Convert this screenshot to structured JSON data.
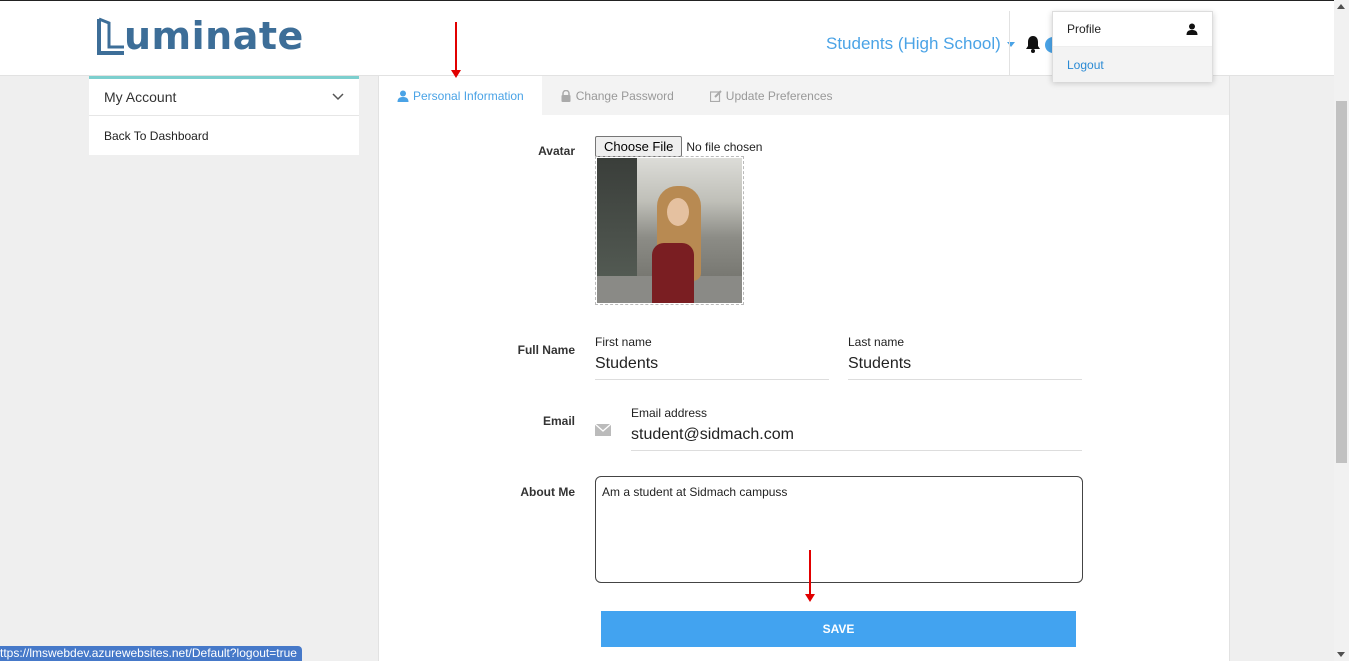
{
  "header": {
    "logo_text": "uminate",
    "role_selector": "Students (High School)",
    "brand_color": "#3d6e98",
    "accent_color": "#4aa3e6"
  },
  "user_menu": {
    "profile_label": "Profile",
    "logout_label": "Logout"
  },
  "sidebar": {
    "section_title": "My Account",
    "items": [
      {
        "label": "Back To Dashboard"
      }
    ]
  },
  "tabs": [
    {
      "label": "Personal Information",
      "icon": "user-icon",
      "active": true
    },
    {
      "label": "Change Password",
      "icon": "lock-icon",
      "active": false
    },
    {
      "label": "Update Preferences",
      "icon": "edit-icon",
      "active": false
    }
  ],
  "form": {
    "avatar_label": "Avatar",
    "choose_file_label": "Choose File",
    "no_file_text": "No file chosen",
    "full_name_label": "Full Name",
    "first_name_caption": "First name",
    "first_name_value": "Students",
    "last_name_caption": "Last name",
    "last_name_value": "Students",
    "email_label": "Email",
    "email_caption": "Email address",
    "email_value": "student@sidmach.com",
    "about_label": "About Me",
    "about_value": "Am a student at Sidmach campuss",
    "save_label": "SAVE"
  },
  "status_bar": {
    "url": "ttps://lmswebdev.azurewebsites.net/Default?logout=true"
  }
}
